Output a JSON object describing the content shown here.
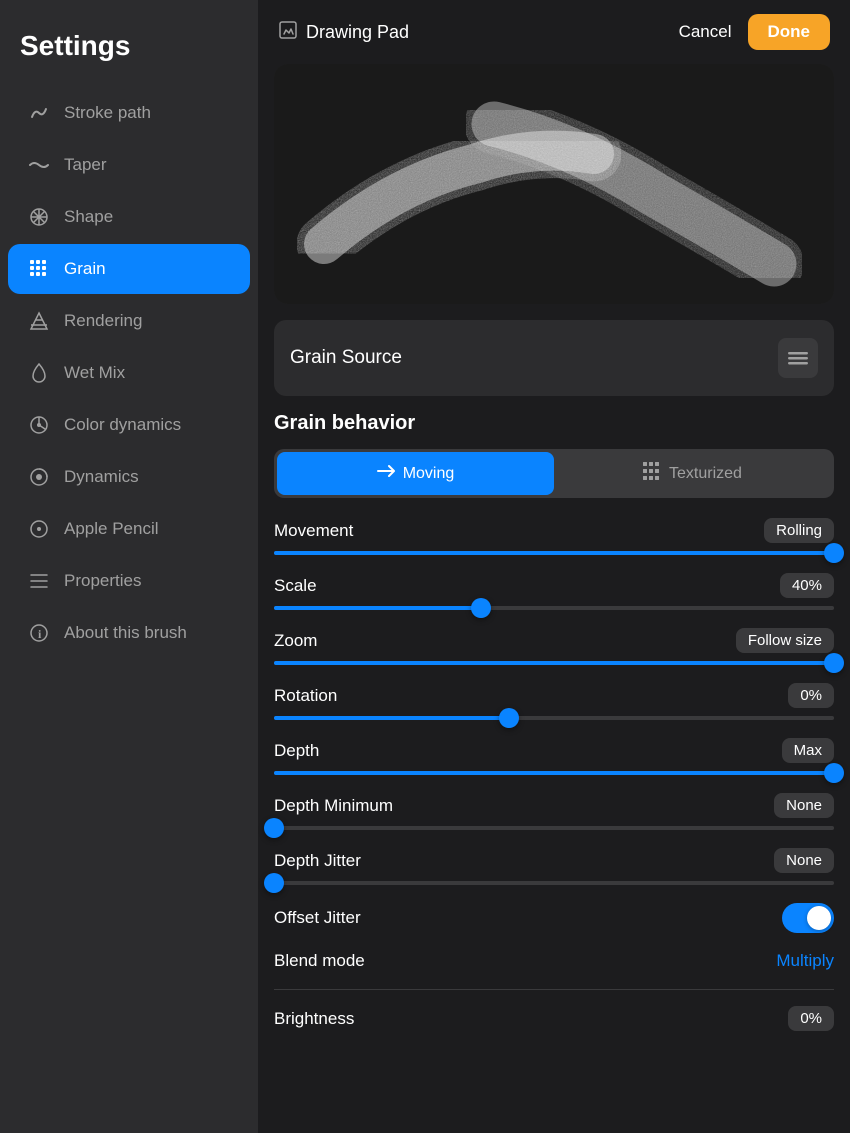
{
  "sidebar": {
    "title": "Settings",
    "items": [
      {
        "id": "stroke-path",
        "label": "Stroke path",
        "icon": "↩"
      },
      {
        "id": "taper",
        "label": "Taper",
        "icon": "〜"
      },
      {
        "id": "shape",
        "label": "Shape",
        "icon": "✳"
      },
      {
        "id": "grain",
        "label": "Grain",
        "icon": "⊞",
        "active": true
      },
      {
        "id": "rendering",
        "label": "Rendering",
        "icon": "▲"
      },
      {
        "id": "wet-mix",
        "label": "Wet Mix",
        "icon": "💧"
      },
      {
        "id": "color-dynamics",
        "label": "Color dynamics",
        "icon": "✼"
      },
      {
        "id": "dynamics",
        "label": "Dynamics",
        "icon": "◑"
      },
      {
        "id": "apple-pencil",
        "label": "Apple Pencil",
        "icon": "ℹ"
      },
      {
        "id": "properties",
        "label": "Properties",
        "icon": "☰"
      },
      {
        "id": "about",
        "label": "About this brush",
        "icon": "ℹ"
      }
    ]
  },
  "topbar": {
    "icon": "✎",
    "title": "Drawing Pad",
    "cancel_label": "Cancel",
    "done_label": "Done"
  },
  "grain_source": {
    "label": "Grain Source",
    "btn_icon": "⋯"
  },
  "grain_behavior": {
    "section_title": "Grain behavior",
    "toggle_moving": "Moving",
    "toggle_texturized": "Texturized",
    "active_toggle": "moving"
  },
  "sliders": {
    "movement": {
      "label": "Movement",
      "value": "Rolling",
      "fill_pct": 100,
      "thumb_pct": 100
    },
    "scale": {
      "label": "Scale",
      "value": "40%",
      "fill_pct": 37,
      "thumb_pct": 37
    },
    "zoom": {
      "label": "Zoom",
      "value": "Follow size",
      "fill_pct": 100,
      "thumb_pct": 100
    },
    "rotation": {
      "label": "Rotation",
      "value": "0%",
      "fill_pct": 42,
      "thumb_pct": 42
    },
    "depth": {
      "label": "Depth",
      "value": "Max",
      "fill_pct": 100,
      "thumb_pct": 100
    },
    "depth_minimum": {
      "label": "Depth Minimum",
      "value": "None",
      "fill_pct": 0,
      "thumb_pct": 0
    },
    "depth_jitter": {
      "label": "Depth Jitter",
      "value": "None",
      "fill_pct": 0,
      "thumb_pct": 0
    }
  },
  "offset_jitter": {
    "label": "Offset Jitter",
    "enabled": true
  },
  "blend_mode": {
    "label": "Blend mode",
    "value": "Multiply"
  },
  "brightness": {
    "label": "Brightness",
    "value": "0%"
  },
  "colors": {
    "accent_blue": "#0a84ff",
    "accent_orange": "#f7a427",
    "bg_dark": "#1c1c1e",
    "bg_card": "#2c2c2e",
    "bg_element": "#3a3a3c"
  }
}
